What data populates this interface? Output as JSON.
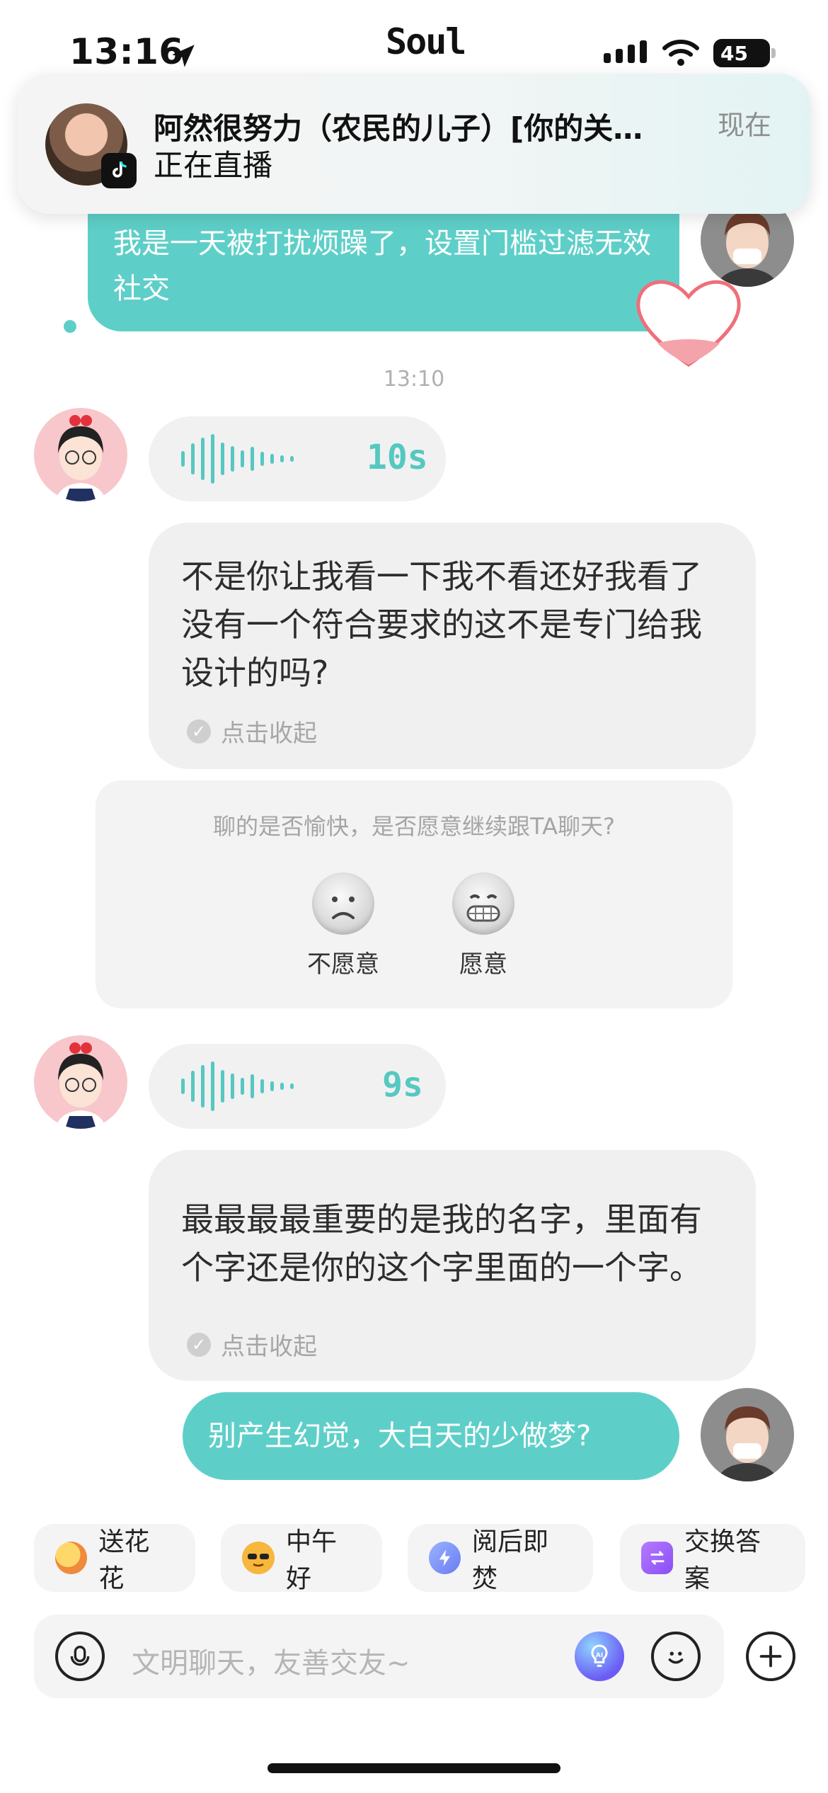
{
  "status_bar": {
    "time": "13:16",
    "app_name": "Soul",
    "battery": "45"
  },
  "notification": {
    "title": "阿然很努力（农民的儿子）[你的关…",
    "subtitle": "正在直播",
    "time": "现在"
  },
  "messages": {
    "m1_text": "我是一天被打扰烦躁了，设置门槛过滤无效社交",
    "timestamp": "13:10",
    "voice1": {
      "duration": "10s",
      "transcript": "不是你让我看一下我不看还好我看了没有一个符合要求的这不是专门给我设计的吗?",
      "collapse": "点击收起"
    },
    "survey": {
      "question": "聊的是否愉快，是否愿意继续跟TA聊天?",
      "no": "不愿意",
      "yes": "愿意"
    },
    "voice2": {
      "duration": "9s",
      "transcript": "最最最最重要的是我的名字，里面有个字还是你的这个字里面的一个字。",
      "collapse": "点击收起"
    },
    "m_last_text": "别产生幻觉，大白天的少做梦?"
  },
  "quick_replies": [
    {
      "label": "送花花",
      "icon": "flower-icon"
    },
    {
      "label": "中午好",
      "icon": "sun-sunglasses-icon"
    },
    {
      "label": "阅后即焚",
      "icon": "lightning-icon"
    },
    {
      "label": "交换答案",
      "icon": "exchange-icon"
    }
  ],
  "input": {
    "placeholder": "文明聊天，友善交友~"
  },
  "colors": {
    "accent": "#5ecfc8",
    "bubble_in": "#f0f0f1",
    "heart": "#ef6f7a"
  }
}
